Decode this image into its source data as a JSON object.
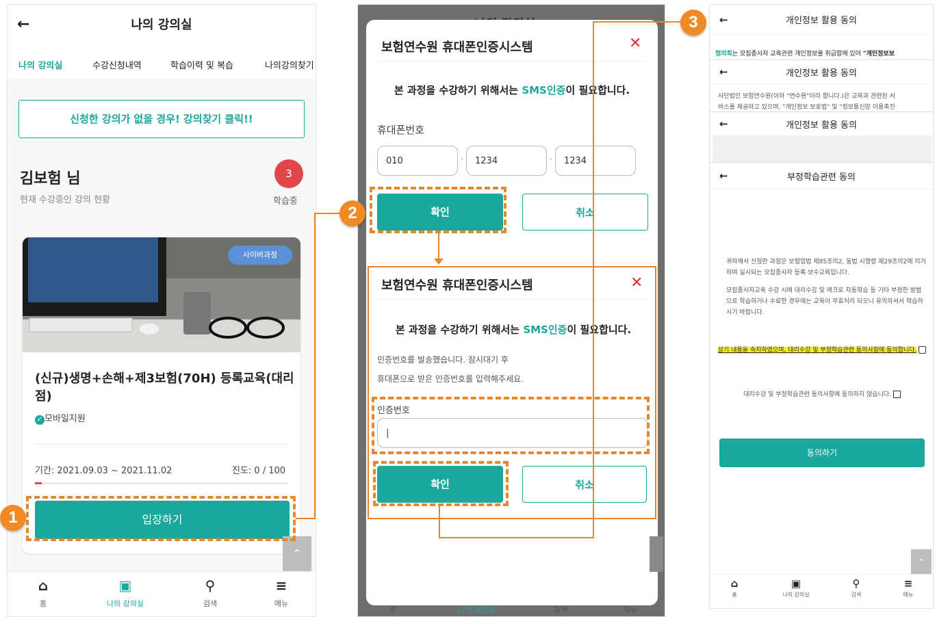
{
  "p1": {
    "title": "나의 강의실",
    "tabs": [
      "나의 강의실",
      "수강신청내역",
      "학습이력 및 복습",
      "나의강의찾기"
    ],
    "banner": "신청한 강의가 없을 경우! 강의찾기 클릭!!",
    "user_name": "김보험 님",
    "user_sub": "현재 수강중인 강의 현황",
    "count": "3",
    "count_label": "학습중",
    "course_tag": "사이버과정",
    "course_title": "(신규)생명+손해+제3보험(70H) 등록교육(대리점)",
    "mobile": "모바일지원",
    "period": "기간: 2021.09.03 ~ 2021.11.02",
    "progress_text": "진도: 0 / 100",
    "progress": 0,
    "enter": "입장하기",
    "nav": [
      "홈",
      "나의 강의실",
      "검색",
      "메뉴"
    ]
  },
  "p2": {
    "bg_title": "나의 강의실",
    "modal_title": "보험연수원 휴대폰인증시스템",
    "msg_pre": "본 과정을 수강하기 위해서는 ",
    "msg_sms": "SMS인증",
    "msg_post": "이 필요합니다.",
    "phone_label": "휴대폰번호",
    "phone": [
      "010",
      "1234",
      "1234"
    ],
    "confirm": "확인",
    "cancel": "취소",
    "sent1": "인증번호를 발송했습니다. 잠시대기 후",
    "sent2": "휴대폰으로 받은 인증번호를 입력해주세요.",
    "code_label": "인증번호",
    "code_value": "|",
    "nav": [
      "홈",
      "나의 강의실",
      "검색",
      "메뉴"
    ]
  },
  "p3": {
    "h1": "개인정보 활용 동의",
    "t1_a": "협의회",
    "t1_b": "는 모집종사자 교육관련 개인정보를 취급함에 있어 ",
    "t1_c": "\"개인정보보",
    "h2": "개인정보 활용 동의",
    "t2a": "사단법인 보험연수원(이하 \"연수원\"이라 합니다.)은 교육과 관련된 서",
    "t2b": "비스를 제공하고 있으며, \"개인정보 보호법\" 및 \"정보통신망 이용촉진",
    "h3": "개인정보 활용 동의",
    "h4": "부정학습관련 동의",
    "p_a": "귀하께서 신청한 과정은 보험업법 제85조의2, 동법 시행령 제29조의2에 의거하여 실시되는 모집종사자 등록·보수교육입니다.",
    "p_b": "모집종사자교육 수강 시에 대리수강 및 매크로 자동학습 등 기타 부정한 방법으로 학습하거나 수료한 경우에는 교육이 무효처리 되오니 유의하셔서 학습하시기 바랍니다.",
    "agree": "상기 내용을 숙지하였으며, 대리수강 및 부정학습관련 동의사항에 동의합니다.",
    "disagree": "대리수강 및 부정학습관련 동의사항에 동의하지 않습니다.",
    "agree_btn": "동의하기",
    "nav": [
      "홈",
      "나의 강의실",
      "검색",
      "메뉴"
    ]
  },
  "steps": [
    "1",
    "2",
    "3"
  ],
  "icons": {
    "back": "arrow-left-icon",
    "close": "close-icon",
    "home": "home-icon",
    "classroom": "classroom-icon",
    "search": "search-icon",
    "menu": "menu-icon",
    "check": "check-circle-icon",
    "scroll": "chevron-up-icon"
  },
  "colors": {
    "accent": "#1aa89c",
    "highlight": "#f08a24",
    "close": "#e03030",
    "count": "#e0474c"
  }
}
